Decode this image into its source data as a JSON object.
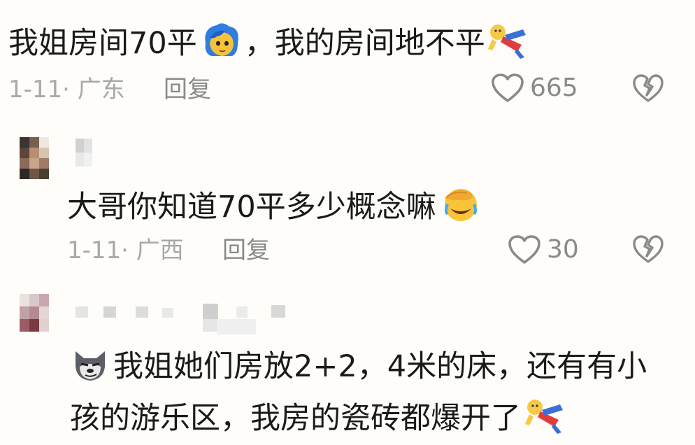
{
  "comments": [
    {
      "text_a": "我姐房间70平",
      "text_b": "，我的房间地不平",
      "emoji_1": "blue-hair-face-emoji",
      "emoji_2": "lying-down-figure-emoji",
      "date_location": "1-11· 广东",
      "reply_label": "回复",
      "likes": "665"
    },
    {
      "text": "大哥你知道70平多少概念嘛",
      "emoji": "facepalm-laughing-emoji",
      "date_location": "1-11· 广西",
      "reply_label": "回复",
      "likes": "30"
    },
    {
      "line1": "我姐她们房放2+2，4米的床，还有有小",
      "line2": "孩的游乐区，我房的瓷砖都爆开了",
      "emoji_lead": "smirking-wolf-emoji",
      "emoji_end": "lying-down-figure-emoji"
    }
  ],
  "icons": {
    "like": "heart-outline-icon",
    "dislike": "broken-heart-outline-icon"
  },
  "colors": {
    "background": "#fefdf9",
    "text": "#1a1a1a",
    "meta": "#a8a8a8"
  }
}
